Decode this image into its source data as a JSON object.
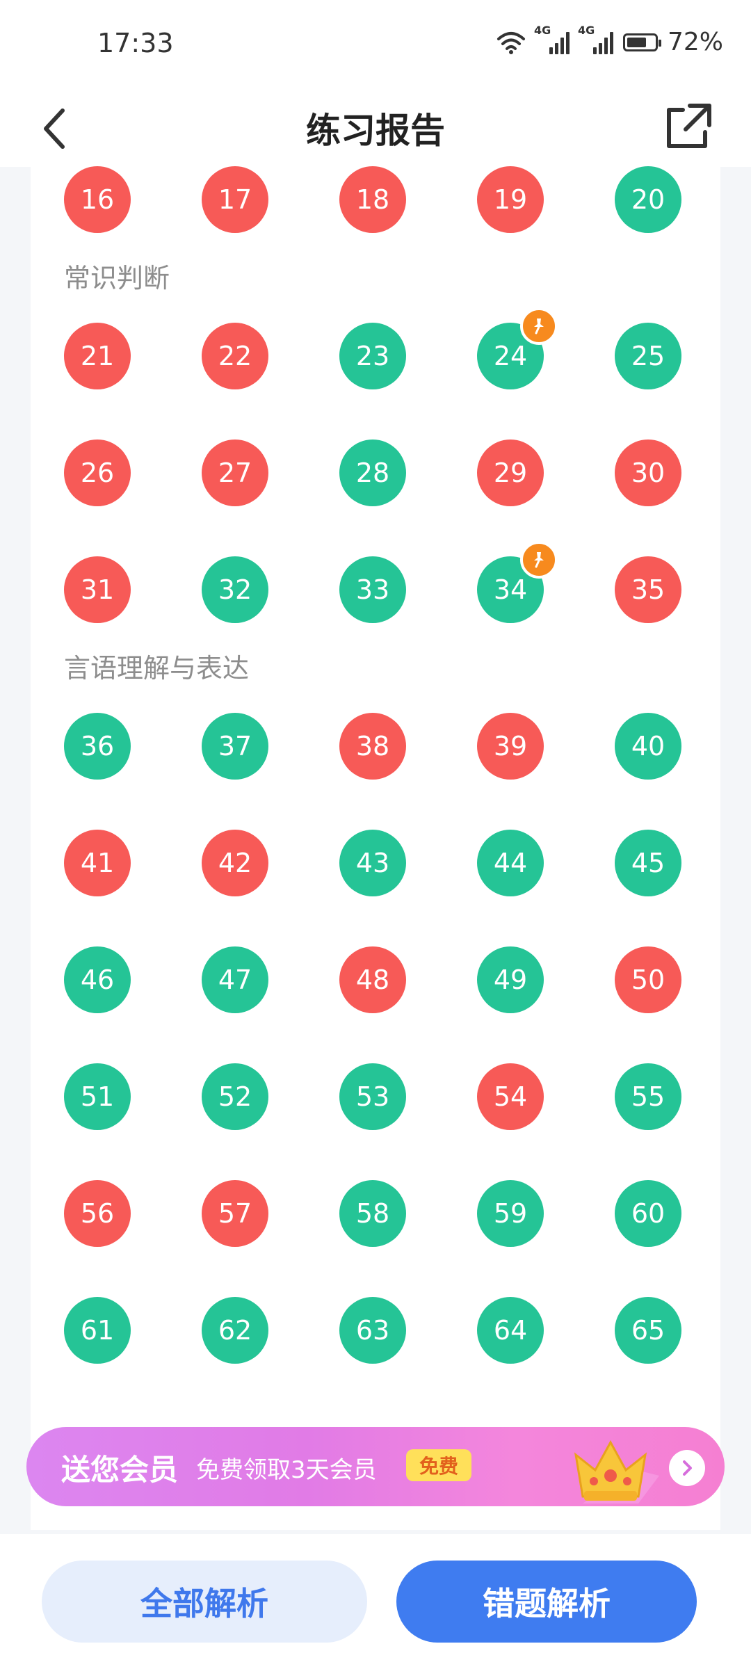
{
  "status": {
    "time": "17:33",
    "network_1": "4G",
    "network_2": "4G",
    "battery": "72%",
    "battery_level": 0.72
  },
  "header": {
    "title": "练习报告",
    "back_icon": "chevron-left-icon",
    "share_icon": "share-external-icon"
  },
  "legend_colors": {
    "wrong": "#f75a57",
    "right": "#25c496",
    "pin": "#f78a1e"
  },
  "partial_row": {
    "items": [
      {
        "num": "16",
        "status": "wrong"
      },
      {
        "num": "17",
        "status": "wrong"
      },
      {
        "num": "18",
        "status": "wrong"
      },
      {
        "num": "19",
        "status": "wrong"
      },
      {
        "num": "20",
        "status": "right"
      }
    ]
  },
  "sections": [
    {
      "title": "常识判断",
      "items": [
        {
          "num": "21",
          "status": "wrong"
        },
        {
          "num": "22",
          "status": "wrong"
        },
        {
          "num": "23",
          "status": "right"
        },
        {
          "num": "24",
          "status": "right",
          "pinned": true
        },
        {
          "num": "25",
          "status": "right"
        },
        {
          "num": "26",
          "status": "wrong"
        },
        {
          "num": "27",
          "status": "wrong"
        },
        {
          "num": "28",
          "status": "right"
        },
        {
          "num": "29",
          "status": "wrong"
        },
        {
          "num": "30",
          "status": "wrong"
        },
        {
          "num": "31",
          "status": "wrong"
        },
        {
          "num": "32",
          "status": "right"
        },
        {
          "num": "33",
          "status": "right"
        },
        {
          "num": "34",
          "status": "right",
          "pinned": true
        },
        {
          "num": "35",
          "status": "wrong"
        }
      ]
    },
    {
      "title": "言语理解与表达",
      "items": [
        {
          "num": "36",
          "status": "right"
        },
        {
          "num": "37",
          "status": "right"
        },
        {
          "num": "38",
          "status": "wrong"
        },
        {
          "num": "39",
          "status": "wrong"
        },
        {
          "num": "40",
          "status": "right"
        },
        {
          "num": "41",
          "status": "wrong"
        },
        {
          "num": "42",
          "status": "wrong"
        },
        {
          "num": "43",
          "status": "right"
        },
        {
          "num": "44",
          "status": "right"
        },
        {
          "num": "45",
          "status": "right"
        },
        {
          "num": "46",
          "status": "right"
        },
        {
          "num": "47",
          "status": "right"
        },
        {
          "num": "48",
          "status": "wrong"
        },
        {
          "num": "49",
          "status": "right"
        },
        {
          "num": "50",
          "status": "wrong"
        },
        {
          "num": "51",
          "status": "right"
        },
        {
          "num": "52",
          "status": "right"
        },
        {
          "num": "53",
          "status": "right"
        },
        {
          "num": "54",
          "status": "wrong"
        },
        {
          "num": "55",
          "status": "right"
        },
        {
          "num": "56",
          "status": "wrong"
        },
        {
          "num": "57",
          "status": "wrong"
        },
        {
          "num": "58",
          "status": "right"
        },
        {
          "num": "59",
          "status": "right"
        },
        {
          "num": "60",
          "status": "right"
        },
        {
          "num": "61",
          "status": "right"
        },
        {
          "num": "62",
          "status": "right"
        },
        {
          "num": "63",
          "status": "right"
        },
        {
          "num": "64",
          "status": "right"
        },
        {
          "num": "65",
          "status": "right"
        }
      ]
    }
  ],
  "promo": {
    "title": "送您会员",
    "subtitle": "免费领取3天会员",
    "badge": "免费",
    "icon": "crown-icon",
    "arrow_icon": "chevron-right-icon"
  },
  "footer": {
    "all_analysis": "全部解析",
    "wrong_analysis": "错题解析"
  }
}
